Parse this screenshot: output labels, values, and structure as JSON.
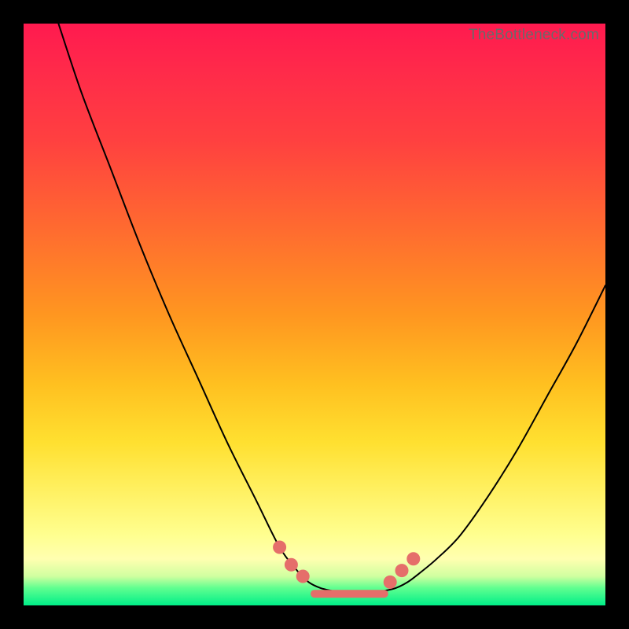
{
  "watermark": "TheBottleneck.com",
  "colors": {
    "frame": "#000000",
    "gradient_top": "#ff1a4f",
    "gradient_bottom": "#00ee88",
    "curve": "#000000",
    "marker": "#e56e6a"
  },
  "chart_data": {
    "type": "line",
    "title": "",
    "xlabel": "",
    "ylabel": "",
    "xlim": [
      0,
      100
    ],
    "ylim": [
      0,
      100
    ],
    "grid": false,
    "legend": false,
    "series": [
      {
        "name": "left-branch",
        "x": [
          6,
          10,
          15,
          20,
          25,
          30,
          35,
          40,
          44,
          47,
          49,
          51,
          53
        ],
        "values": [
          100,
          88,
          75,
          62,
          50,
          39,
          28,
          18,
          10,
          6,
          4,
          3,
          2.5
        ]
      },
      {
        "name": "right-branch",
        "x": [
          62,
          64,
          66,
          68,
          71,
          75,
          80,
          85,
          90,
          95,
          100
        ],
        "values": [
          2.5,
          3,
          4,
          5.5,
          8,
          12,
          19,
          27,
          36,
          45,
          55
        ]
      }
    ],
    "markers": {
      "name": "highlighted-points",
      "x": [
        44,
        46,
        48,
        63,
        65,
        67
      ],
      "values": [
        10,
        7,
        5,
        4,
        6,
        8
      ]
    },
    "flat_segment": {
      "name": "trough-bar",
      "x": [
        50,
        62
      ],
      "y": 2
    }
  }
}
